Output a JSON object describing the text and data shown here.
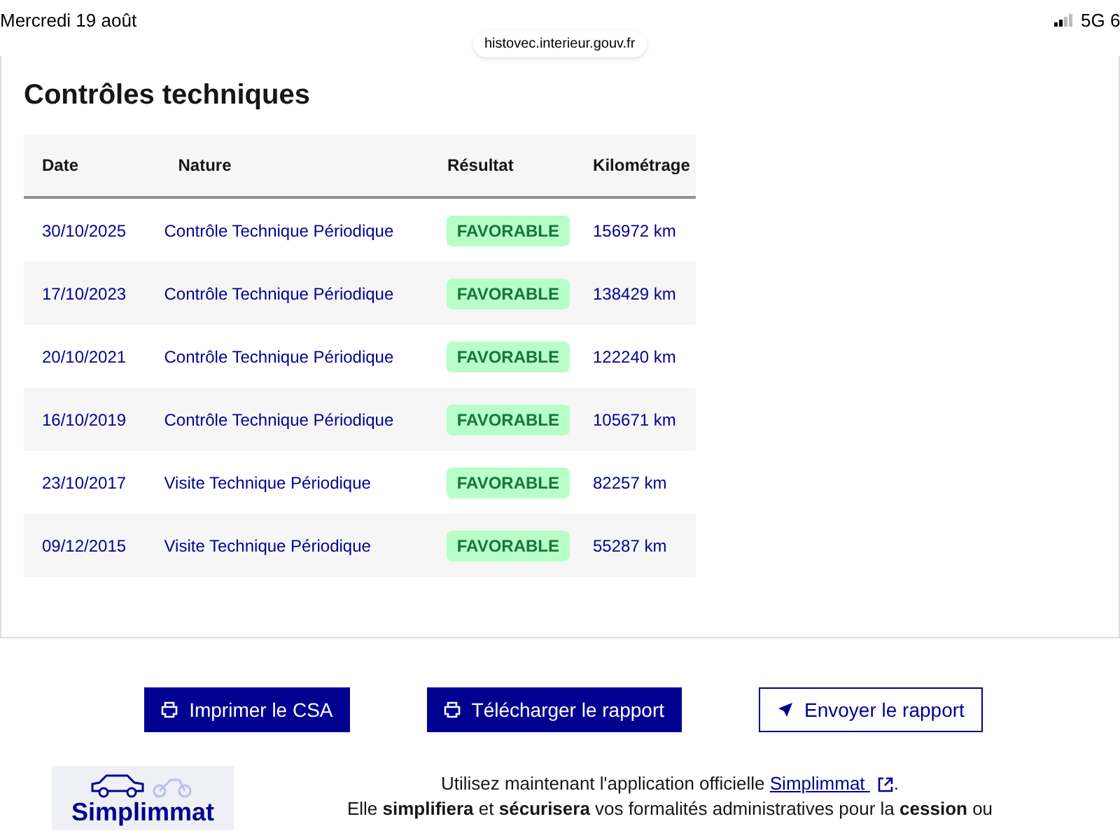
{
  "status_bar": {
    "date": "Mercredi 19 août",
    "network": "5G 6",
    "url": "histovec.interieur.gouv.fr"
  },
  "section": {
    "title": "Contrôles techniques"
  },
  "table": {
    "columns": [
      "Date",
      "Nature",
      "Résultat",
      "Kilométrage"
    ],
    "rows": [
      {
        "date": "30/10/2025",
        "nature": "Contrôle Technique Périodique",
        "result": "FAVORABLE",
        "mileage": "156972 km"
      },
      {
        "date": "17/10/2023",
        "nature": "Contrôle Technique Périodique",
        "result": "FAVORABLE",
        "mileage": "138429 km"
      },
      {
        "date": "20/10/2021",
        "nature": "Contrôle Technique Périodique",
        "result": "FAVORABLE",
        "mileage": "122240 km"
      },
      {
        "date": "16/10/2019",
        "nature": "Contrôle Technique Périodique",
        "result": "FAVORABLE",
        "mileage": "105671 km"
      },
      {
        "date": "23/10/2017",
        "nature": "Visite Technique Périodique",
        "result": "FAVORABLE",
        "mileage": "82257 km"
      },
      {
        "date": "09/12/2015",
        "nature": "Visite Technique Périodique",
        "result": "FAVORABLE",
        "mileage": "55287 km"
      }
    ]
  },
  "actions": [
    {
      "label": "Imprimer le CSA",
      "kind": "print",
      "primary": true
    },
    {
      "label": "Télécharger le rapport",
      "kind": "print",
      "primary": true
    },
    {
      "label": "Envoyer le rapport",
      "kind": "send",
      "primary": false
    }
  ],
  "promo": {
    "logo_text": "Simplimmat",
    "line_1_before": "Utilisez maintenant l'application officielle",
    "link": "Simplimmat",
    "line_1_after": ".",
    "line_2": "Elle **simplifiera** et **sécurisera** vos formalités administratives pour la **cession** ou"
  }
}
